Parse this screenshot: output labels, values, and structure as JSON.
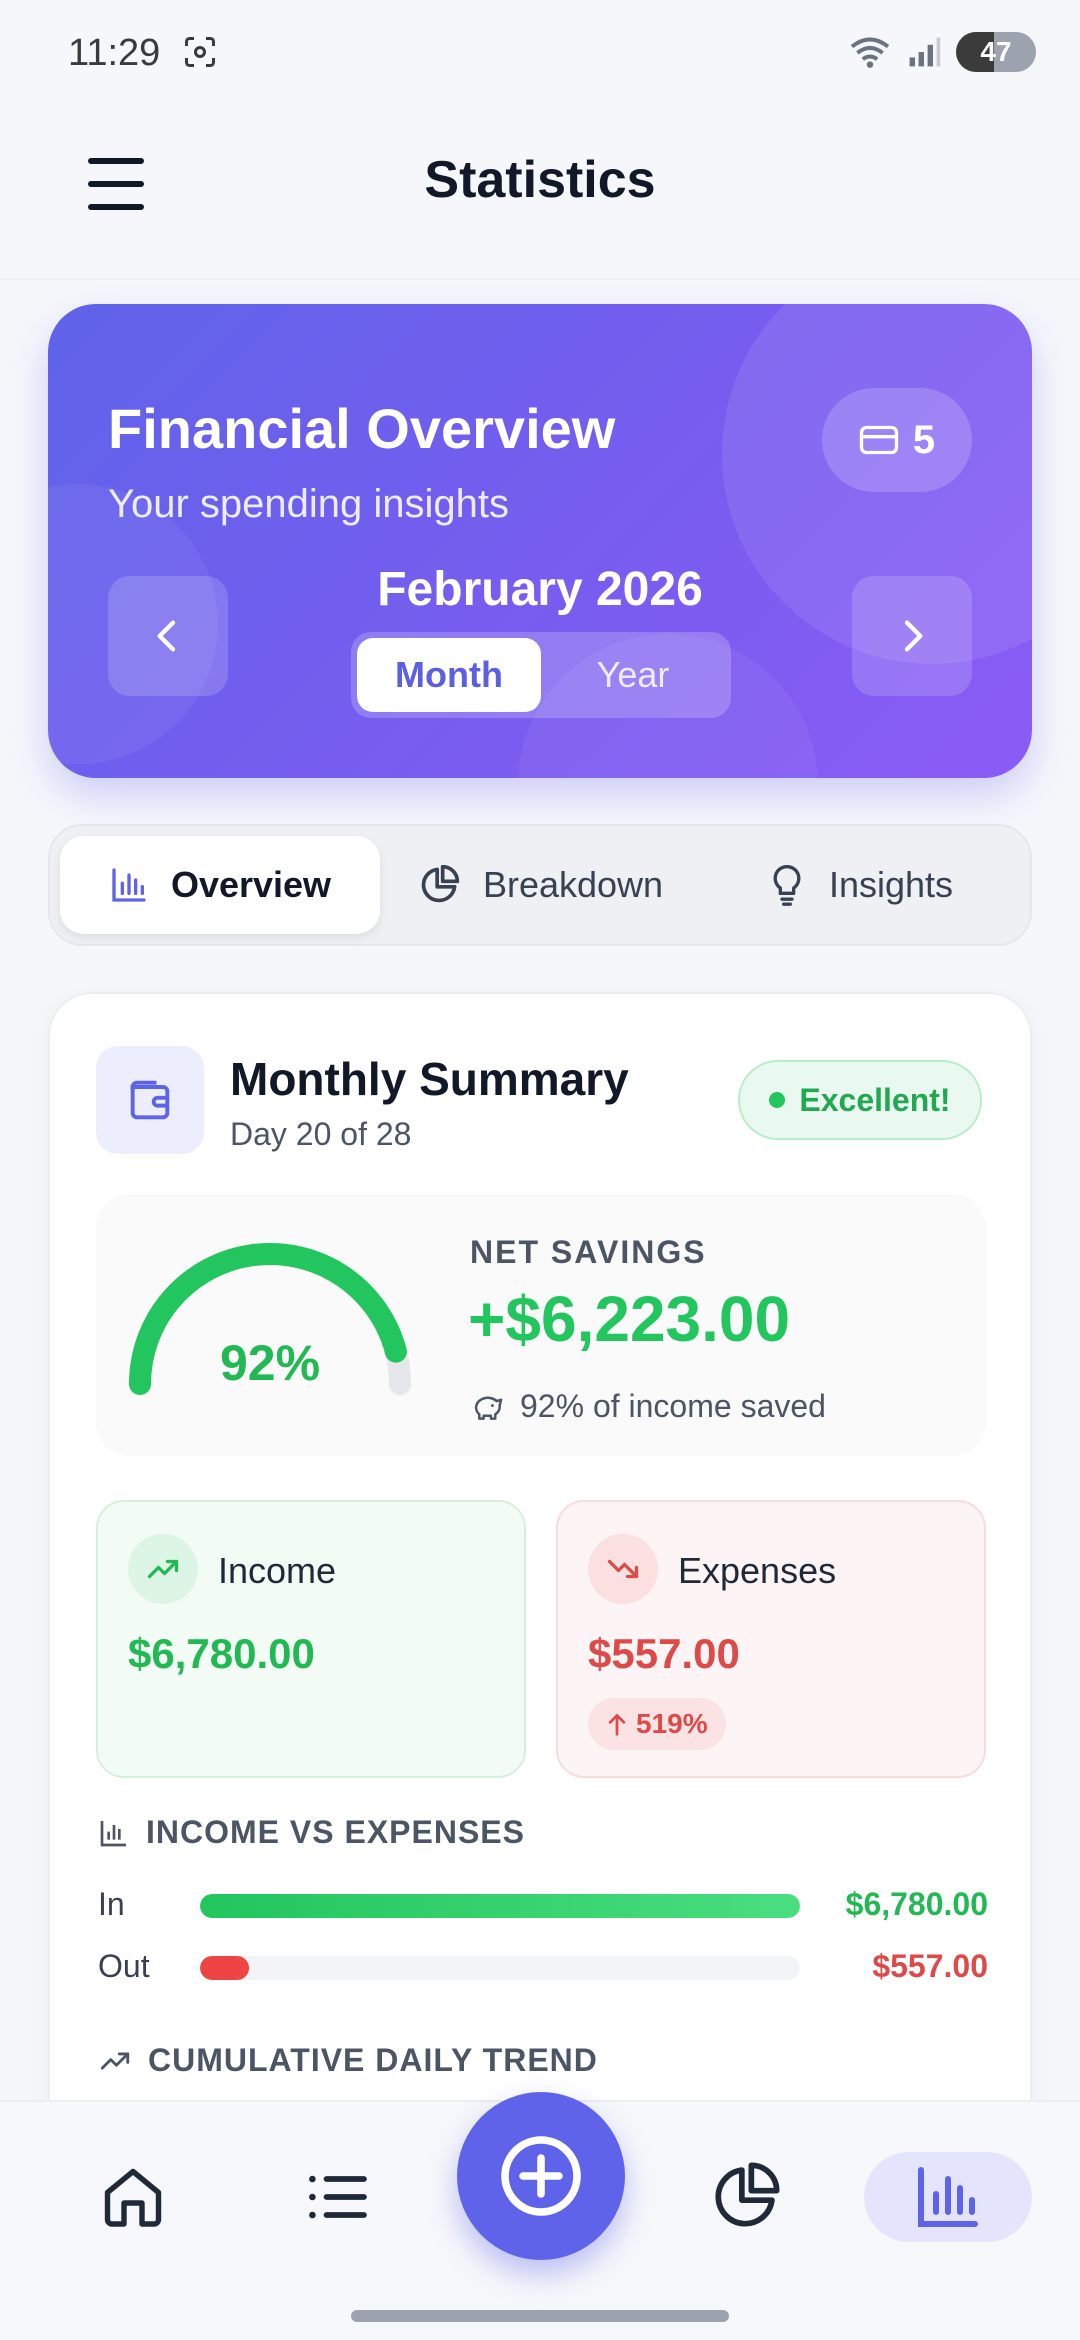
{
  "status_bar": {
    "time": "11:29",
    "battery": "47"
  },
  "header": {
    "title": "Statistics"
  },
  "hero": {
    "title": "Financial Overview",
    "subtitle": "Your spending insights",
    "card_count": "5",
    "period": "February 2026",
    "toggle": {
      "month": "Month",
      "year": "Year",
      "selected": "Month"
    }
  },
  "tabs": [
    {
      "label": "Overview",
      "active": true
    },
    {
      "label": "Breakdown",
      "active": false
    },
    {
      "label": "Insights",
      "active": false
    }
  ],
  "summary": {
    "title": "Monthly Summary",
    "subtitle": "Day 20 of 28",
    "badge": "Excellent!",
    "gauge_percent": "92%",
    "savings_fraction": 0.92,
    "net_label": "NET SAVINGS",
    "net_value": "+$6,223.00",
    "net_note": "92% of income saved",
    "income": {
      "label": "Income",
      "value": "$6,780.00"
    },
    "expenses": {
      "label": "Expenses",
      "value": "$557.00",
      "change": "519%"
    },
    "compare": {
      "title": "INCOME VS EXPENSES",
      "in_label": "In",
      "in_value": "$6,780.00",
      "in_fraction": 1.0,
      "out_label": "Out",
      "out_value": "$557.00",
      "out_fraction": 0.082
    },
    "trend_title": "CUMULATIVE DAILY TREND"
  },
  "colors": {
    "accent": "#5f63ea",
    "positive": "#22c55e",
    "negative": "#ef4444"
  },
  "bottom_nav": {
    "items": [
      "home-icon",
      "list-icon",
      "add-icon",
      "pie-chart-icon",
      "bar-chart-icon"
    ],
    "active": "bar-chart-icon"
  }
}
